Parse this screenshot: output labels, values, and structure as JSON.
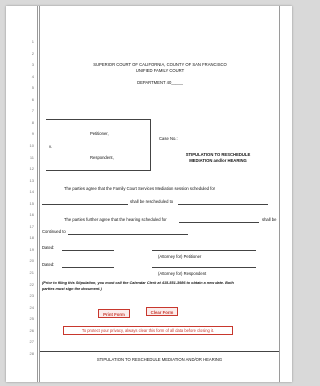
{
  "line_numbers": [
    "1",
    "2",
    "3",
    "4",
    "5",
    "6",
    "7",
    "8",
    "9",
    "10",
    "11",
    "12",
    "13",
    "14",
    "15",
    "16",
    "17",
    "18",
    "19",
    "20",
    "21",
    "22",
    "23",
    "24",
    "25",
    "26",
    "27",
    "28"
  ],
  "court": {
    "name": "SUPERIOR COURT OF CALIFORNIA, COUNTY OF SAN FRANCISCO",
    "division": "UNIFIED FAMILY COURT",
    "department": "DEPARTMENT 40_____"
  },
  "caption": {
    "petitioner_label": "Petitioner,",
    "vs_label": "v.",
    "respondent_label": "Respondent,",
    "case_no_label": "Case No.:",
    "doc_title_line1": "STIPULATION TO RESCHEDULE",
    "doc_title_line2": "MEDIATION and/or HEARING"
  },
  "body": {
    "mediation_text": "The parties agree that the Family Court Services Mediation session scheduled for",
    "rescheduled_text": "shall be rescheduled to",
    "hearing_text_start": "The parties further agree that the hearing scheduled for",
    "hearing_text_end": "shall be",
    "continued_text": "Continued to"
  },
  "signatures": {
    "dated_label_1": "Dated:",
    "attorney_petitioner": "(Attorney for) Petitioner",
    "dated_label_2": "Dated:",
    "attorney_respondent": "(Attorney for) Respondent"
  },
  "instructions": {
    "line1": "(Prior to filing this Stipulation, you must call the Calendar Clerk at 415-551-3986 to obtain a new date.  Both",
    "line2": "parties must sign the document.)"
  },
  "buttons": {
    "print_label": "Print Form",
    "clear_label": "Clear Form"
  },
  "privacy_notice": "To protect your privacy, always clear this form of all data before closing it.",
  "footer": "STIPULATION TO RESCHEDULE MEDIATION AND/OR HEARING"
}
